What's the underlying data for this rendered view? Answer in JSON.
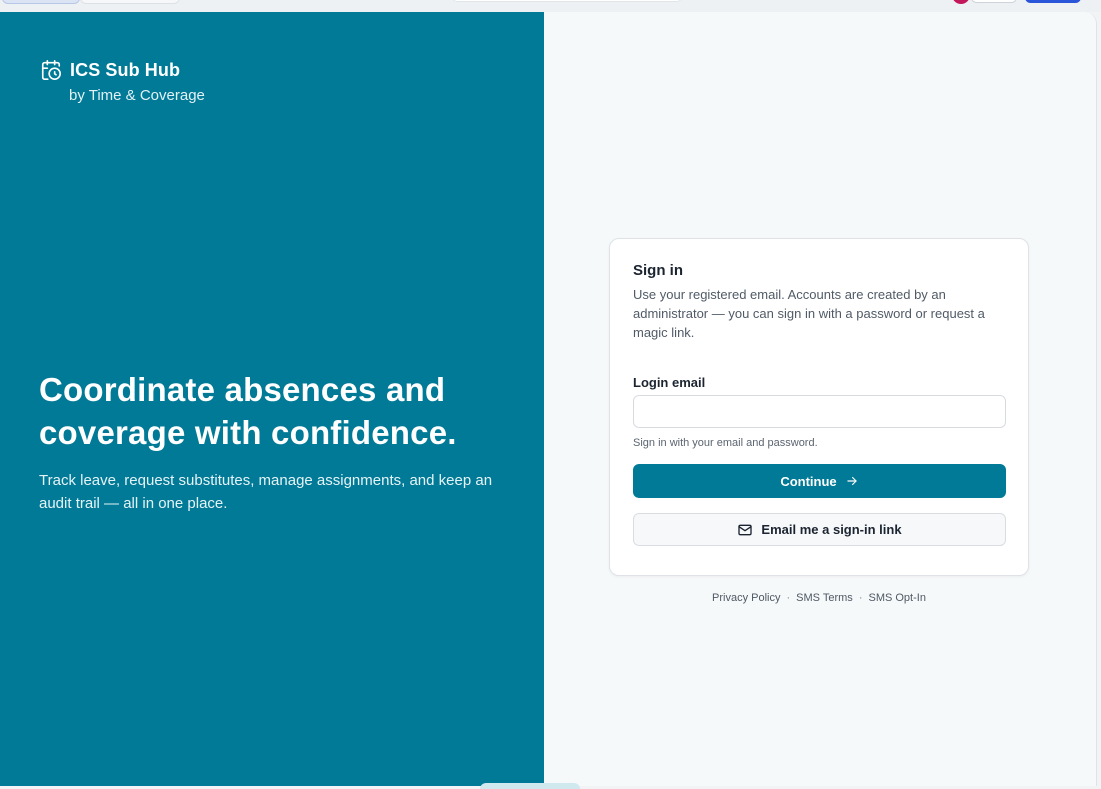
{
  "brand": {
    "icon": "calendar-clock-icon",
    "title": "ICS Sub Hub",
    "subtitle": "by Time & Coverage"
  },
  "hero": {
    "title": "Coordinate absences and coverage with confidence.",
    "text": "Track leave, request substitutes, manage assignments, and keep an audit trail — all in one place."
  },
  "signin": {
    "title": "Sign in",
    "description": "Use your registered email. Accounts are created by an administrator — you can sign in with a password or request a magic link.",
    "email_label": "Login email",
    "email_value": "",
    "hint": "Sign in with your email and password.",
    "continue_label": "Continue",
    "continue_icon": "arrow-right-icon",
    "magic_link_label": "Email me a sign-in link",
    "magic_link_icon": "mail-icon"
  },
  "footer": {
    "links": [
      "Privacy Policy",
      "SMS Terms",
      "SMS Opt-In"
    ],
    "separator": "·"
  },
  "colors": {
    "brand": "#007a96",
    "panel_bg": "#f6f9fa",
    "text_dark": "#1b2430"
  }
}
